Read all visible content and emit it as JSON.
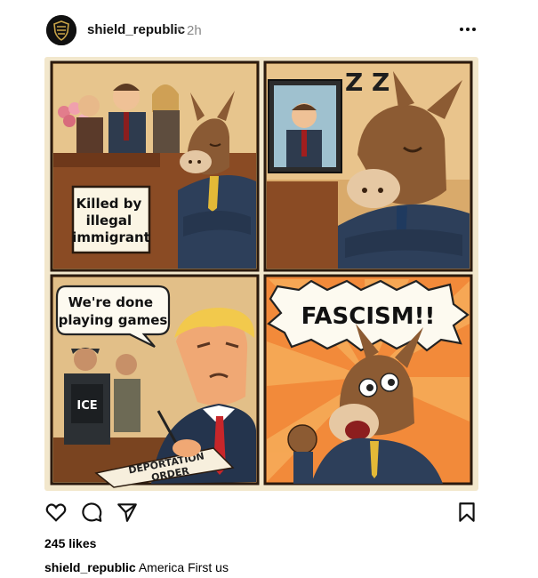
{
  "post": {
    "username": "shield_republic",
    "separator": "•",
    "time": "2h",
    "likes": "245 likes",
    "caption_user": "shield_republic",
    "caption_text": "America First us"
  },
  "comic": {
    "panel1_sign": [
      "Killed by",
      "illegal",
      "immigrant"
    ],
    "panel2_zz": "Z Z",
    "panel3_bubble": [
      "We're done",
      "playing games"
    ],
    "panel3_vest": "ICE",
    "panel3_paper": [
      "DEPORTATION",
      "ORDER"
    ],
    "panel4_shout": "FASCISM!!"
  },
  "icons": {
    "more": "more-options-icon",
    "heart": "heart-icon",
    "comment": "comment-icon",
    "share": "share-icon",
    "save": "bookmark-icon"
  }
}
